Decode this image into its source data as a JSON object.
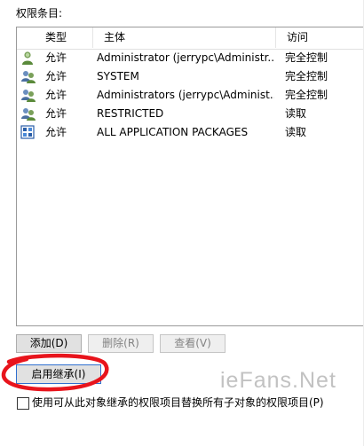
{
  "section_label": "权限条目:",
  "columns": [
    "类型",
    "主体",
    "访问"
  ],
  "entries": [
    {
      "type": "允许",
      "principal": "Administrator (jerrypc\\Administr...",
      "access": "完全控制",
      "icon": "user-icon"
    },
    {
      "type": "允许",
      "principal": "SYSTEM",
      "access": "完全控制",
      "icon": "group-icon"
    },
    {
      "type": "允许",
      "principal": "Administrators (jerrypc\\Administ...",
      "access": "完全控制",
      "icon": "group-icon"
    },
    {
      "type": "允许",
      "principal": "RESTRICTED",
      "access": "读取",
      "icon": "group-icon"
    },
    {
      "type": "允许",
      "principal": "ALL APPLICATION PACKAGES",
      "access": "读取",
      "icon": "app-packages-icon"
    }
  ],
  "buttons": {
    "add": "添加(D)",
    "remove": "删除(R)",
    "view": "查看(V)",
    "enable_inheritance": "启用继承(I)"
  },
  "checkbox_label": "使用可从此对象继承的权限项目替换所有子对象的权限项目(P)",
  "watermark": "ieFans.Net",
  "colors": {
    "annotation_red": "#e8141c",
    "focus_blue": "#2f6fcf"
  }
}
